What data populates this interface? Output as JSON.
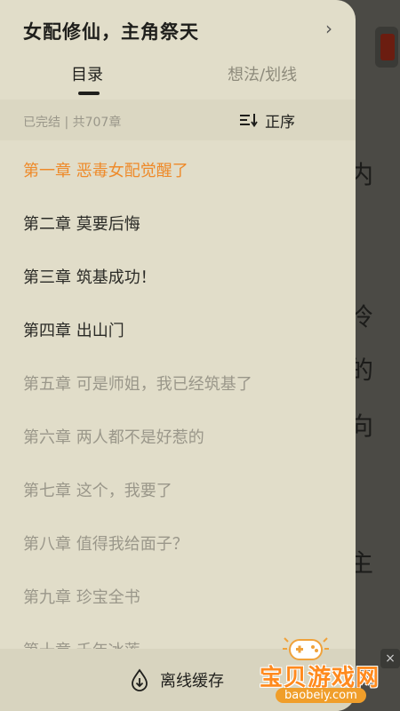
{
  "book": {
    "title": "女配修仙，主角祭天"
  },
  "tabs": [
    {
      "label": "目录",
      "active": true
    },
    {
      "label": "想法/划线",
      "active": false
    }
  ],
  "meta": {
    "status": "已完结 | 共707章"
  },
  "sort": {
    "label": "正序"
  },
  "chapters": [
    {
      "label": "第一章 恶毒女配觉醒了",
      "state": "current"
    },
    {
      "label": "第二章 莫要后悔",
      "state": "read"
    },
    {
      "label": "第三章 筑基成功！",
      "state": "read"
    },
    {
      "label": "第四章 出山门",
      "state": "read"
    },
    {
      "label": "第五章 可是师姐，我已经筑基了",
      "state": "unread"
    },
    {
      "label": "第六章 两人都不是好惹的",
      "state": "unread"
    },
    {
      "label": "第七章 这个，我要了",
      "state": "unread"
    },
    {
      "label": "第八章 值得我给面子？",
      "state": "unread"
    },
    {
      "label": "第九章 珍宝全书",
      "state": "unread"
    },
    {
      "label": "第十章 千年冰莲",
      "state": "unread"
    }
  ],
  "footer": {
    "offline_label": "离线缓存"
  },
  "background_text": [
    "内",
    "冷",
    "的",
    "向",
    "主"
  ],
  "watermark": {
    "title": "宝贝游戏网",
    "url": "baobeiy.com"
  },
  "colors": {
    "accent": "#ee8a2a",
    "drawer_bg": "#e1ddc9"
  }
}
